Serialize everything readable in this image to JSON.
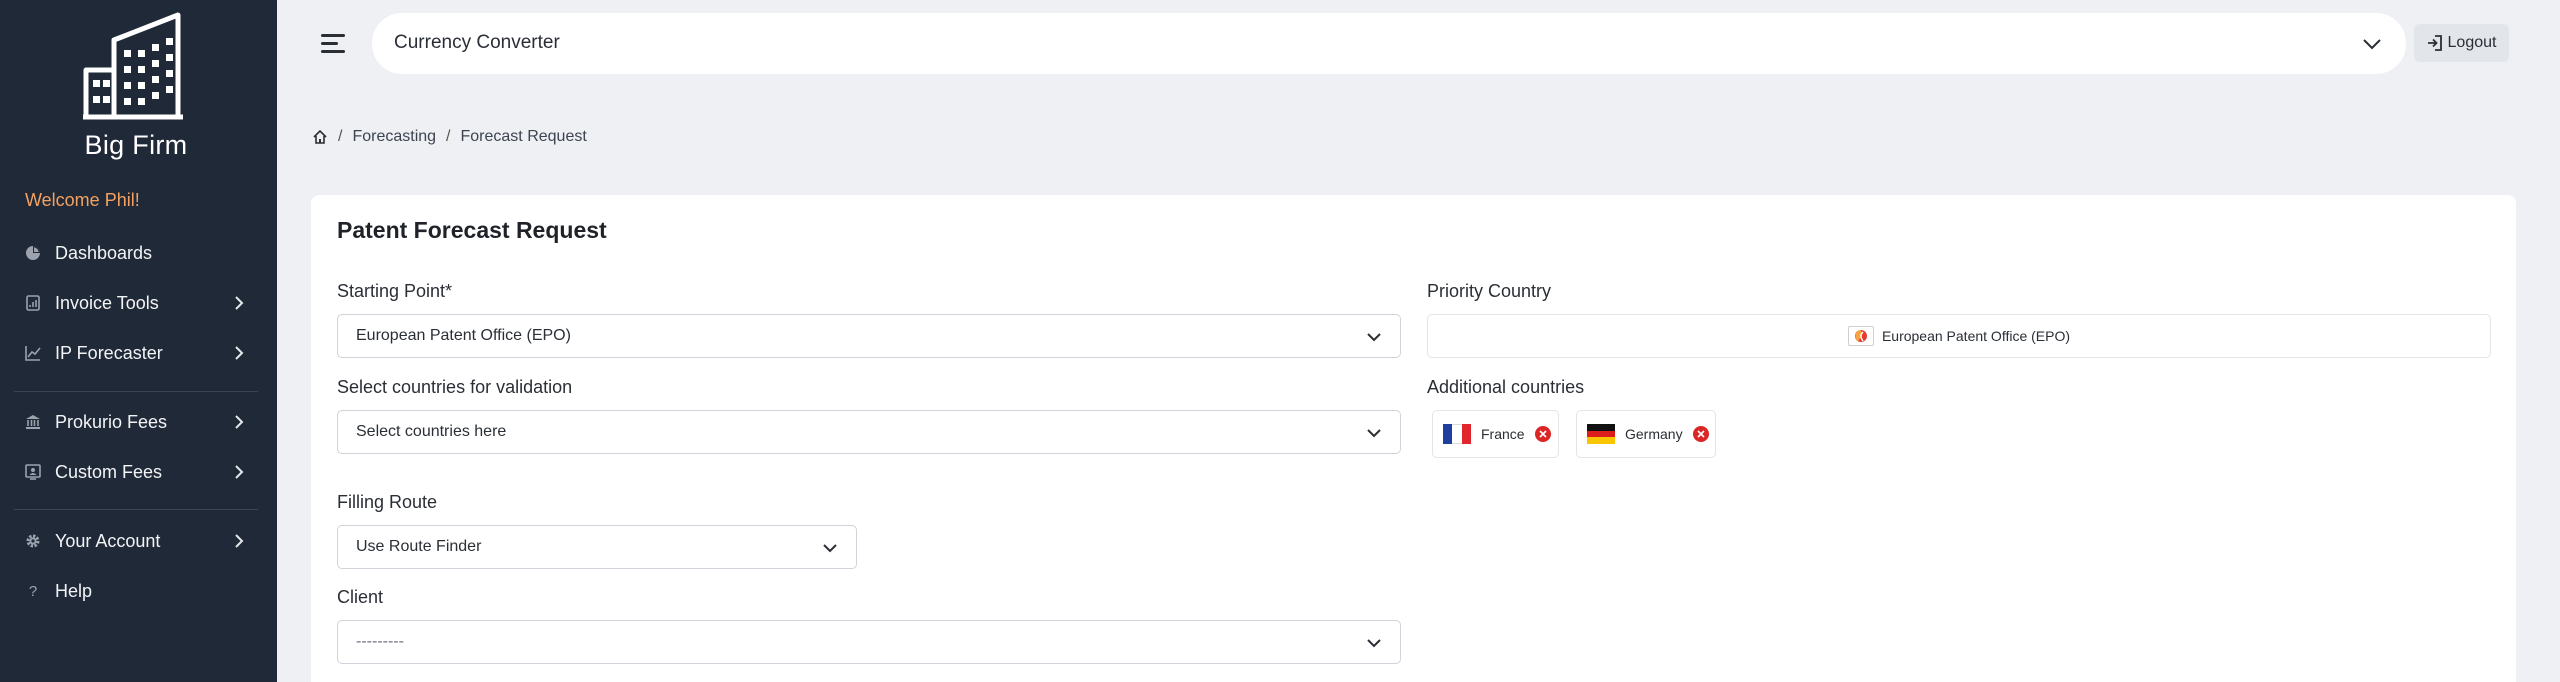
{
  "sidebar": {
    "brand": "Big Firm",
    "welcome": "Welcome Phil!",
    "items": [
      {
        "label": "Dashboards",
        "icon": "pie-chart-icon",
        "has_submenu": false
      },
      {
        "label": "Invoice Tools",
        "icon": "invoice-icon",
        "has_submenu": true
      },
      {
        "label": "IP Forecaster",
        "icon": "line-chart-icon",
        "has_submenu": true
      },
      {
        "label": "Prokurio Fees",
        "icon": "bank-icon",
        "has_submenu": true
      },
      {
        "label": "Custom Fees",
        "icon": "presentation-icon",
        "has_submenu": true
      },
      {
        "label": "Your Account",
        "icon": "gear-icon",
        "has_submenu": true
      },
      {
        "label": "Help",
        "icon": "question-icon",
        "has_submenu": false
      }
    ]
  },
  "header": {
    "selector_value": "Currency Converter",
    "logout_label": "Logout"
  },
  "breadcrumb": {
    "items": [
      "Forecasting",
      "Forecast Request"
    ]
  },
  "form": {
    "title": "Patent Forecast Request",
    "starting_point": {
      "label": "Starting Point*",
      "value": "European Patent Office (EPO)"
    },
    "priority_country": {
      "label": "Priority Country",
      "value": "European Patent Office (EPO)"
    },
    "validation_countries": {
      "label": "Select countries for validation",
      "placeholder": "Select countries here"
    },
    "additional_countries": {
      "label": "Additional countries",
      "chips": [
        "France",
        "Germany"
      ]
    },
    "filing_route": {
      "label": "Filling Route",
      "value": "Use Route Finder"
    },
    "client": {
      "label": "Client",
      "value": "---------"
    }
  },
  "colors": {
    "sidebar_bg": "#1f2937",
    "welcome": "#f4a261",
    "page_bg": "#eef0f3",
    "remove_chip": "#dc2626"
  }
}
